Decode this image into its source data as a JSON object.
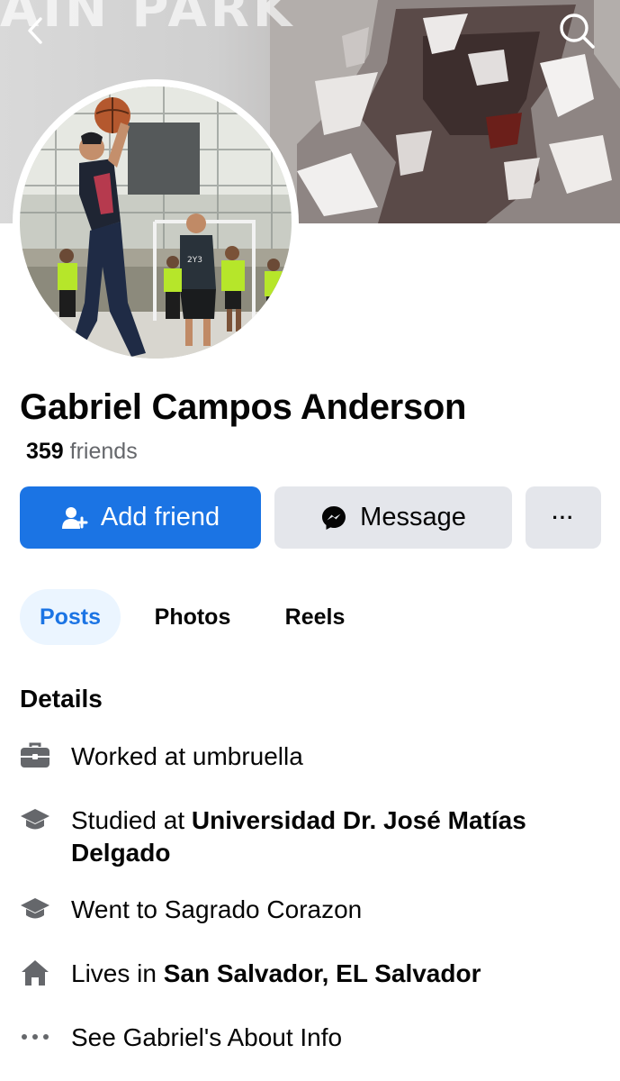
{
  "cover": {
    "band_text": "AIN PARK"
  },
  "nav": {
    "back_icon": "chevron-left-icon",
    "search_icon": "search-icon"
  },
  "profile": {
    "name": "Gabriel Campos Anderson",
    "friends_count": "359",
    "friends_label": " friends"
  },
  "actions": {
    "add_friend": "Add friend",
    "message": "Message",
    "more": "···"
  },
  "tabs": [
    {
      "label": "Posts",
      "active": true
    },
    {
      "label": "Photos",
      "active": false
    },
    {
      "label": "Reels",
      "active": false
    }
  ],
  "details": {
    "title": "Details",
    "items": [
      {
        "icon": "briefcase-icon",
        "prefix": "Worked at umbruella",
        "bold": ""
      },
      {
        "icon": "graduation-cap-icon",
        "prefix": "Studied at ",
        "bold": "Universidad Dr. José Matías Delgado"
      },
      {
        "icon": "graduation-cap-icon",
        "prefix": "Went to Sagrado Corazon",
        "bold": ""
      },
      {
        "icon": "home-icon",
        "prefix": "Lives in ",
        "bold": "San Salvador, EL Salvador"
      },
      {
        "icon": "more-dots-icon",
        "prefix": "See Gabriel's About Info",
        "bold": ""
      }
    ]
  },
  "colors": {
    "accent": "#1b74e4",
    "secondary_button": "#e4e6eb",
    "tab_active_bg": "#ebf5ff",
    "muted_text": "#65676b"
  }
}
